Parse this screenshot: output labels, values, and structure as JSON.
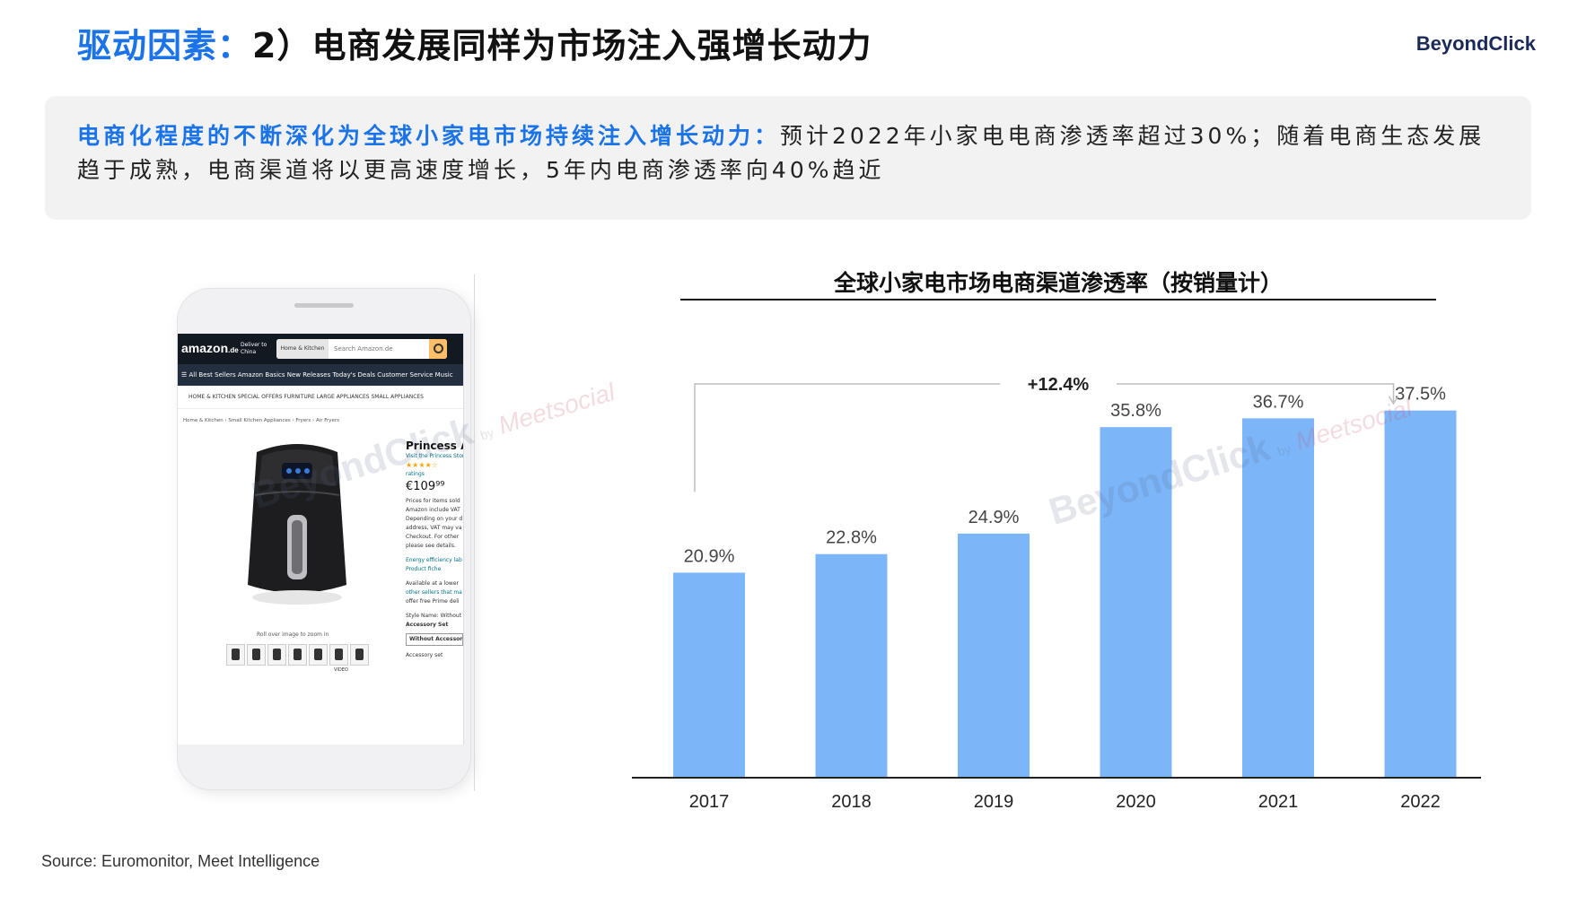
{
  "header": {
    "title_prefix": "驱动因素：",
    "title_main": "2）电商发展同样为市场注入强增长动力",
    "logo": "BeyondClick"
  },
  "callout": {
    "highlight": "电商化程度的不断深化为全球小家电市场持续注入增长动力：",
    "body": "预计2022年小家电电商渗透率超过30%；随着电商生态发展趋于成熟，电商渠道将以更高速度增长，5年内电商渗透率向40%趋近"
  },
  "phone": {
    "logo": "amazon",
    "logo_suffix": ".de",
    "deliver_line1": "Deliver to",
    "deliver_line2": "China",
    "search_category": "Home & Kitchen",
    "search_placeholder": "Search Amazon.de",
    "nav": "☰ All   Best Sellers   Amazon Basics   New Releases   Today's Deals   Customer Service   Music",
    "subnav": "HOME & KITCHEN    SPECIAL OFFERS    FURNITURE    LARGE APPLIANCES    SMALL APPLIANCES",
    "breadcrumb": "Home & Kitchen › Small Kitchen Appliances › Fryers › Air Fryers",
    "product_title": "Princess Aer",
    "store_link": "Visit the Princess Store",
    "stars": "★★★★☆",
    "ratings": "ratings",
    "price": "€109⁹⁹",
    "price_note_1": "Prices for items sold",
    "price_note_2": "Amazon include VAT",
    "price_note_3": "Depending on your d",
    "price_note_4": "address, VAT may va",
    "price_note_5": "Checkout. For other",
    "price_note_6": "please see details.",
    "energy_1": "Energy efficiency lab",
    "energy_2": "Product fiche",
    "available_1": "Available at a lower",
    "available_2": "other sellers that ma",
    "available_3": "offer free Prime deli",
    "style_1": "Style Name: Without",
    "style_2": "Accessory Set",
    "option_box": "Without Accessor",
    "option_2": "Accessory set",
    "zoom_hint": "Roll over image to zoom in",
    "video_label": "VIDEO"
  },
  "chart_data": {
    "type": "bar",
    "title": "全球小家电市场电商渠道渗透率（按销量计）",
    "categories": [
      "2017",
      "2018",
      "2019",
      "2020",
      "2021",
      "2022"
    ],
    "values": [
      20.9,
      22.8,
      24.9,
      35.8,
      36.7,
      37.5
    ],
    "value_labels": [
      "20.9%",
      "22.8%",
      "24.9%",
      "35.8%",
      "36.7%",
      "37.5%"
    ],
    "ylim": [
      0,
      45
    ],
    "grid": false,
    "bar_color": "#7cb5f8",
    "annotation": "+12.4%"
  },
  "watermark": {
    "brand": "BeyondClick",
    "by": "by",
    "partner": "Meetsocial"
  },
  "footer": {
    "source": "Source: Euromonitor, Meet Intelligence"
  },
  "colors": {
    "accent": "#1a73e8",
    "callout_bg": "#f2f2f2"
  }
}
